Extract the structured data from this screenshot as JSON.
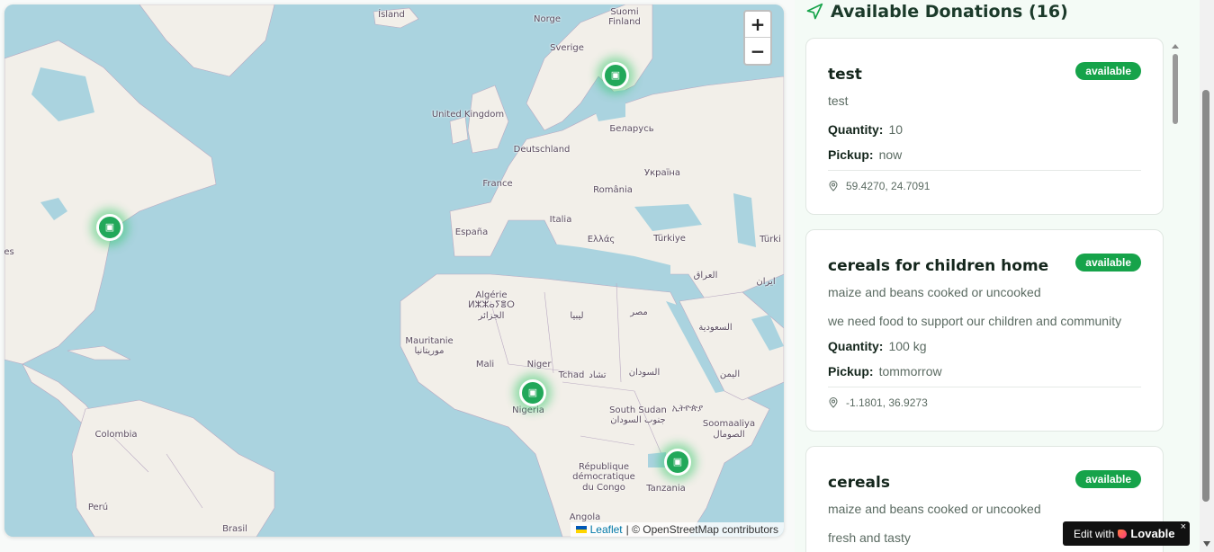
{
  "map": {
    "labels": [
      "Ísland",
      "Norge",
      "Suomi",
      "Finland",
      "Sverige",
      "United Kingdom",
      "Беларусь",
      "Deutschland",
      "Україна",
      "France",
      "România",
      "Italia",
      "España",
      "Ελλάς",
      "Türkiye",
      "Türki",
      "es",
      "العراق",
      "ایران",
      "Algérie",
      "ⵍⵣⵣⴰⵢⴻⵔ",
      "الجزائر",
      "ليبيا",
      "مصر",
      "السعودية",
      "Mauritanie",
      "موريتانيا",
      "Mali",
      "Niger",
      "Tchad",
      "تشاد",
      "السودان",
      "اليمن",
      "Nigeria",
      "South Sudan",
      "جنوب السودان",
      "ኢትዮጵያ",
      "Soomaaliya",
      "الصومال",
      "Colombia",
      "République",
      "démocratique",
      "du Congo",
      "Tanzania",
      "Perú",
      "Brasil",
      "Angola"
    ],
    "zoom_in": "+",
    "zoom_out": "−",
    "attribution_link": "Leaflet",
    "attribution_text": "| © OpenStreetMap contributors",
    "markers": [
      "donation-marker",
      "donation-marker",
      "donation-marker",
      "donation-marker"
    ]
  },
  "sidebar": {
    "title": "Available Donations (16)",
    "donations": [
      {
        "title": "test",
        "status": "available",
        "description": "test",
        "quantity_label": "Quantity:",
        "quantity": "10",
        "pickup_label": "Pickup:",
        "pickup": "now",
        "location": "59.4270, 24.7091"
      },
      {
        "title": "cereals for children home",
        "status": "available",
        "description": "maize and beans cooked or uncooked",
        "note": "we need food to support our children and community",
        "quantity_label": "Quantity:",
        "quantity": "100 kg",
        "pickup_label": "Pickup:",
        "pickup": "tommorrow",
        "location": "-1.1801, 36.9273"
      },
      {
        "title": "cereals",
        "status": "available",
        "description": "maize and beans cooked or uncooked",
        "note": "fresh and tasty"
      }
    ]
  },
  "lovable": {
    "edit_with": "Edit with",
    "brand": "Lovable",
    "close": "×"
  },
  "colors": {
    "accent": "#16a34a",
    "water": "#aad3df",
    "land": "#f2efe9"
  }
}
